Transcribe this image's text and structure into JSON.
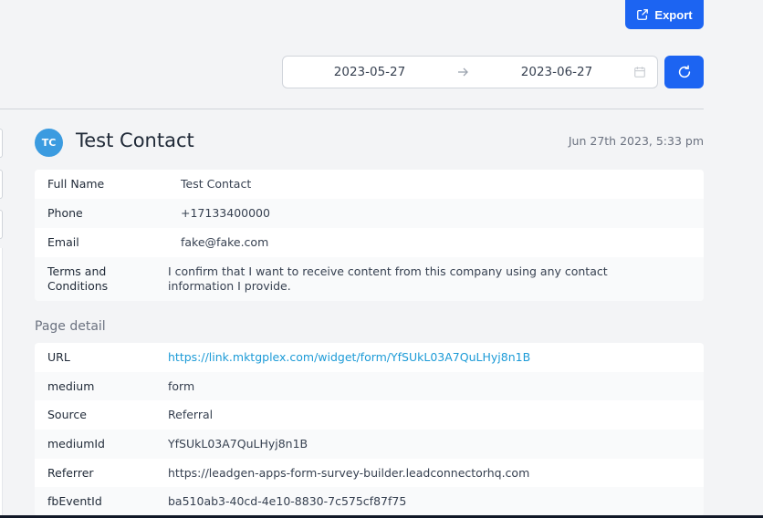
{
  "toolbar": {
    "export_label": "Export"
  },
  "date_range": {
    "start": "2023-05-27",
    "end": "2023-06-27"
  },
  "contact": {
    "initials": "TC",
    "name": "Test Contact",
    "submitted_at": "Jun 27th 2023, 5:33 pm",
    "avatar_color": "#3b9be0"
  },
  "contact_fields": [
    {
      "label": "Full Name",
      "value": "Test Contact"
    },
    {
      "label": "Phone",
      "value": "+17133400000"
    },
    {
      "label": "Email",
      "value": "fake@fake.com"
    },
    {
      "label": "Terms and Conditions",
      "value": "I confirm that I want to receive content from this company using any contact information I provide."
    }
  ],
  "page_detail": {
    "title": "Page detail",
    "fields": [
      {
        "label": "URL",
        "value": "https://link.mktgplex.com/widget/form/YfSUkL03A7QuLHyj8n1B"
      },
      {
        "label": "medium",
        "value": "form"
      },
      {
        "label": "Source",
        "value": "Referral"
      },
      {
        "label": "mediumId",
        "value": "YfSUkL03A7QuLHyj8n1B"
      },
      {
        "label": "Referrer",
        "value": "https://leadgen-apps-form-survey-builder.leadconnectorhq.com"
      },
      {
        "label": "fbEventId",
        "value": "ba510ab3-40cd-4e10-8830-7c575cf87f75"
      }
    ]
  },
  "colors": {
    "primary": "#1c64f2",
    "link": "#1d9bd7",
    "background": "#f3f4f6"
  }
}
